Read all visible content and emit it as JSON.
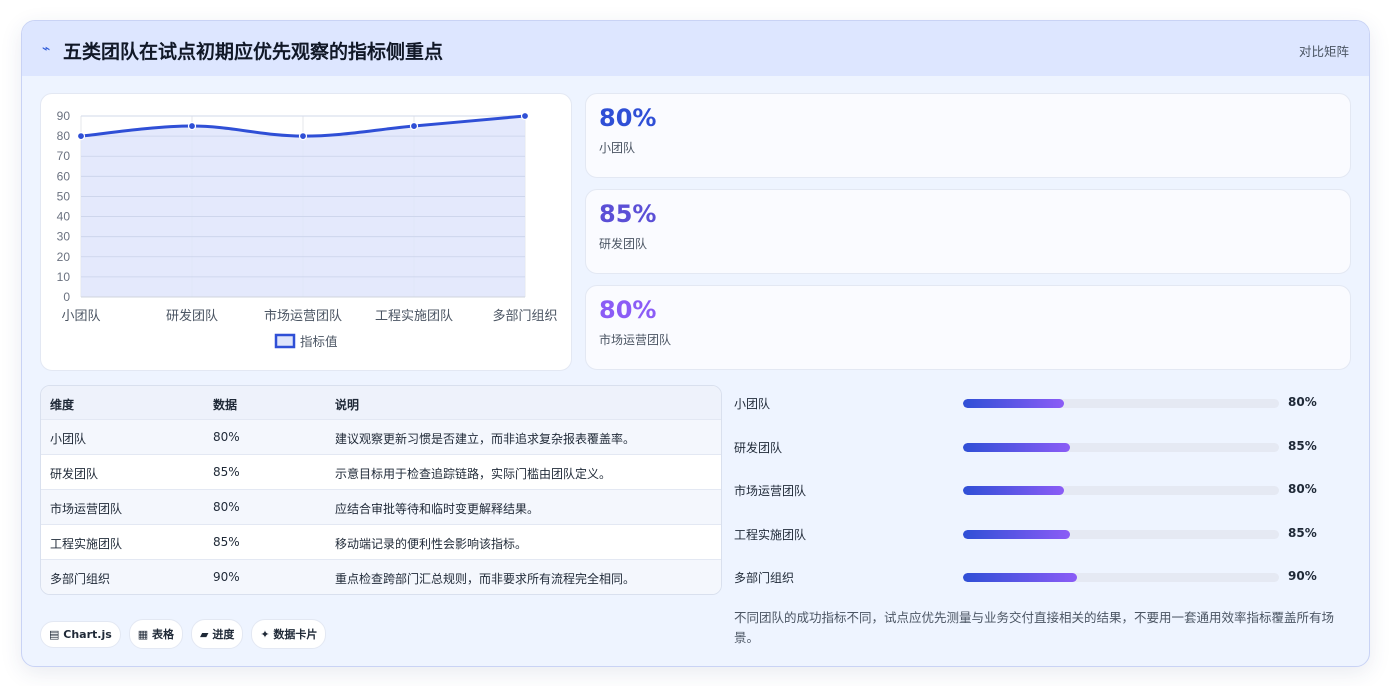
{
  "header": {
    "icon": "pulse-icon",
    "title": "五类团队在试点初期应优先观察的指标侧重点",
    "mode_label": "对比矩阵"
  },
  "chart_data": {
    "type": "area",
    "categories": [
      "小团队",
      "研发团队",
      "市场运营团队",
      "工程实施团队",
      "多部门组织"
    ],
    "series": [
      {
        "name": "指标值",
        "values": [
          80,
          85,
          80,
          85,
          90
        ]
      }
    ],
    "ylim": [
      0,
      90
    ],
    "yticks": [
      0,
      10,
      20,
      30,
      40,
      50,
      60,
      70,
      80,
      90
    ],
    "grid": true,
    "legend": "bottom",
    "line_color": "#2f4fd6",
    "fill_color": "#dfe5fb"
  },
  "kpis": [
    {
      "value": "80%",
      "label": "小团队",
      "color": "#2f4fd6"
    },
    {
      "value": "85%",
      "label": "研发团队",
      "color": "#5b4fd6"
    },
    {
      "value": "80%",
      "label": "市场运营团队",
      "color": "#8b5cf6"
    }
  ],
  "table": {
    "headers": [
      "维度",
      "数据",
      "说明"
    ],
    "rows": [
      [
        "小团队",
        "80%",
        "建议观察更新习惯是否建立，而非追求复杂报表覆盖率。"
      ],
      [
        "研发团队",
        "85%",
        "示意目标用于检查追踪链路，实际门槛由团队定义。"
      ],
      [
        "市场运营团队",
        "80%",
        "应结合审批等待和临时变更解释结果。"
      ],
      [
        "工程实施团队",
        "85%",
        "移动端记录的便利性会影响该指标。"
      ],
      [
        "多部门组织",
        "90%",
        "重点检查跨部门汇总规则，而非要求所有流程完全相同。"
      ]
    ]
  },
  "progress": [
    {
      "label": "小团队",
      "value": "80%",
      "level": 80
    },
    {
      "label": "研发团队",
      "value": "85%",
      "level": 85
    },
    {
      "label": "市场运营团队",
      "value": "80%",
      "level": 80
    },
    {
      "label": "工程实施团队",
      "value": "85%",
      "level": 85
    },
    {
      "label": "多部门组织",
      "value": "90%",
      "level": 90
    }
  ],
  "note": "不同团队的成功指标不同，试点应优先测量与业务交付直接相关的结果，不要用一套通用效率指标覆盖所有场景。",
  "pills": [
    {
      "icon": "chart-icon",
      "glyph": "▤",
      "label": "Chart.js"
    },
    {
      "icon": "table-icon",
      "glyph": "▦",
      "label": "表格"
    },
    {
      "icon": "progress-icon",
      "glyph": "▰",
      "label": "进度"
    },
    {
      "icon": "sparkle-icon",
      "glyph": "✦",
      "label": "数据卡片"
    }
  ]
}
